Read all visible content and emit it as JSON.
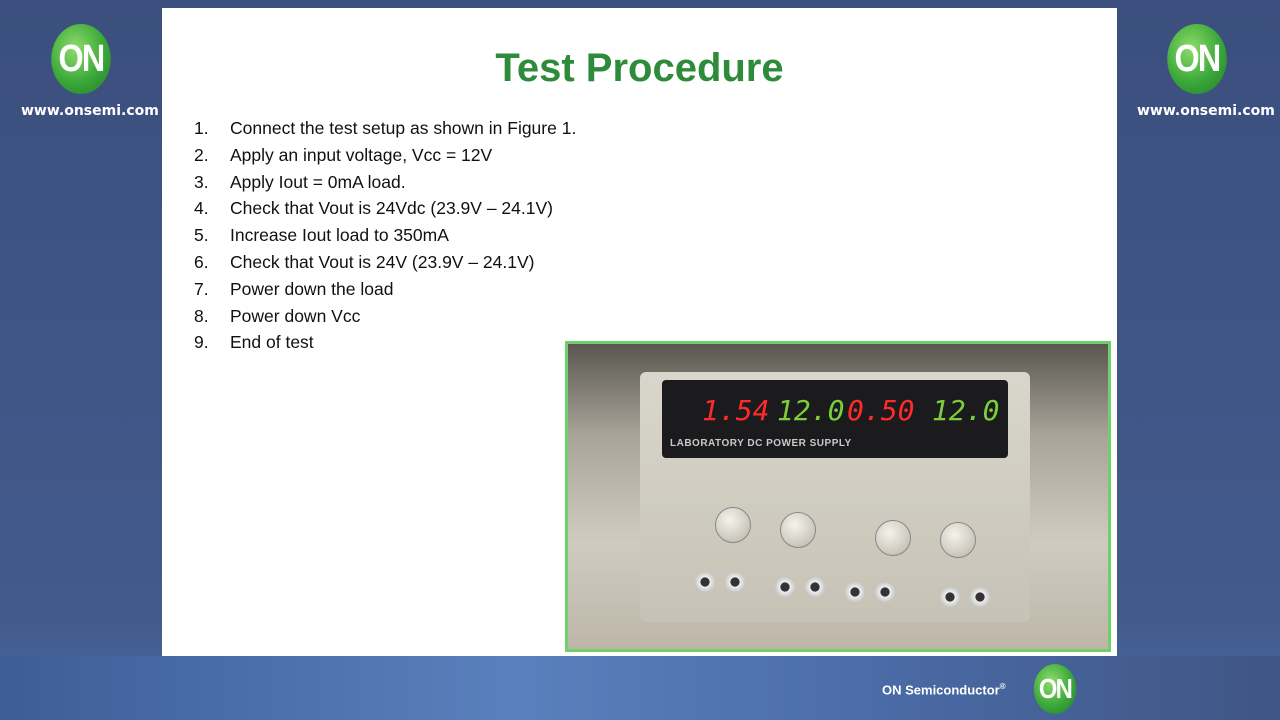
{
  "brand": {
    "url": "www.onsemi.com",
    "logo_text": "ON",
    "company": "ON Semiconductor",
    "registered": "®",
    "colors": {
      "green": "#2e8b3a",
      "background": "#3f5584"
    }
  },
  "slide": {
    "title": "Test Procedure",
    "steps": [
      {
        "n": "1.",
        "text": "Connect the test setup as shown in Figure 1."
      },
      {
        "n": "2.",
        "text": "Apply an input voltage, Vcc = 12V"
      },
      {
        "n": "3.",
        "text": "Apply Iout = 0mA load."
      },
      {
        "n": "4.",
        "text": "Check that Vout is 24Vdc (23.9V – 24.1V)"
      },
      {
        "n": "5.",
        "text": "Increase Iout load to 350mA"
      },
      {
        "n": "6.",
        "text": "Check that Vout is 24V (23.9V – 24.1V)"
      },
      {
        "n": "7.",
        "text": "Power down the load"
      },
      {
        "n": "8.",
        "text": "Power down Vcc"
      },
      {
        "n": "9.",
        "text": "End of test"
      }
    ],
    "photo": {
      "readings": [
        "1.54",
        "12.0",
        "0.50",
        "12.0"
      ],
      "label": "LABORATORY DC POWER SUPPLY"
    }
  }
}
